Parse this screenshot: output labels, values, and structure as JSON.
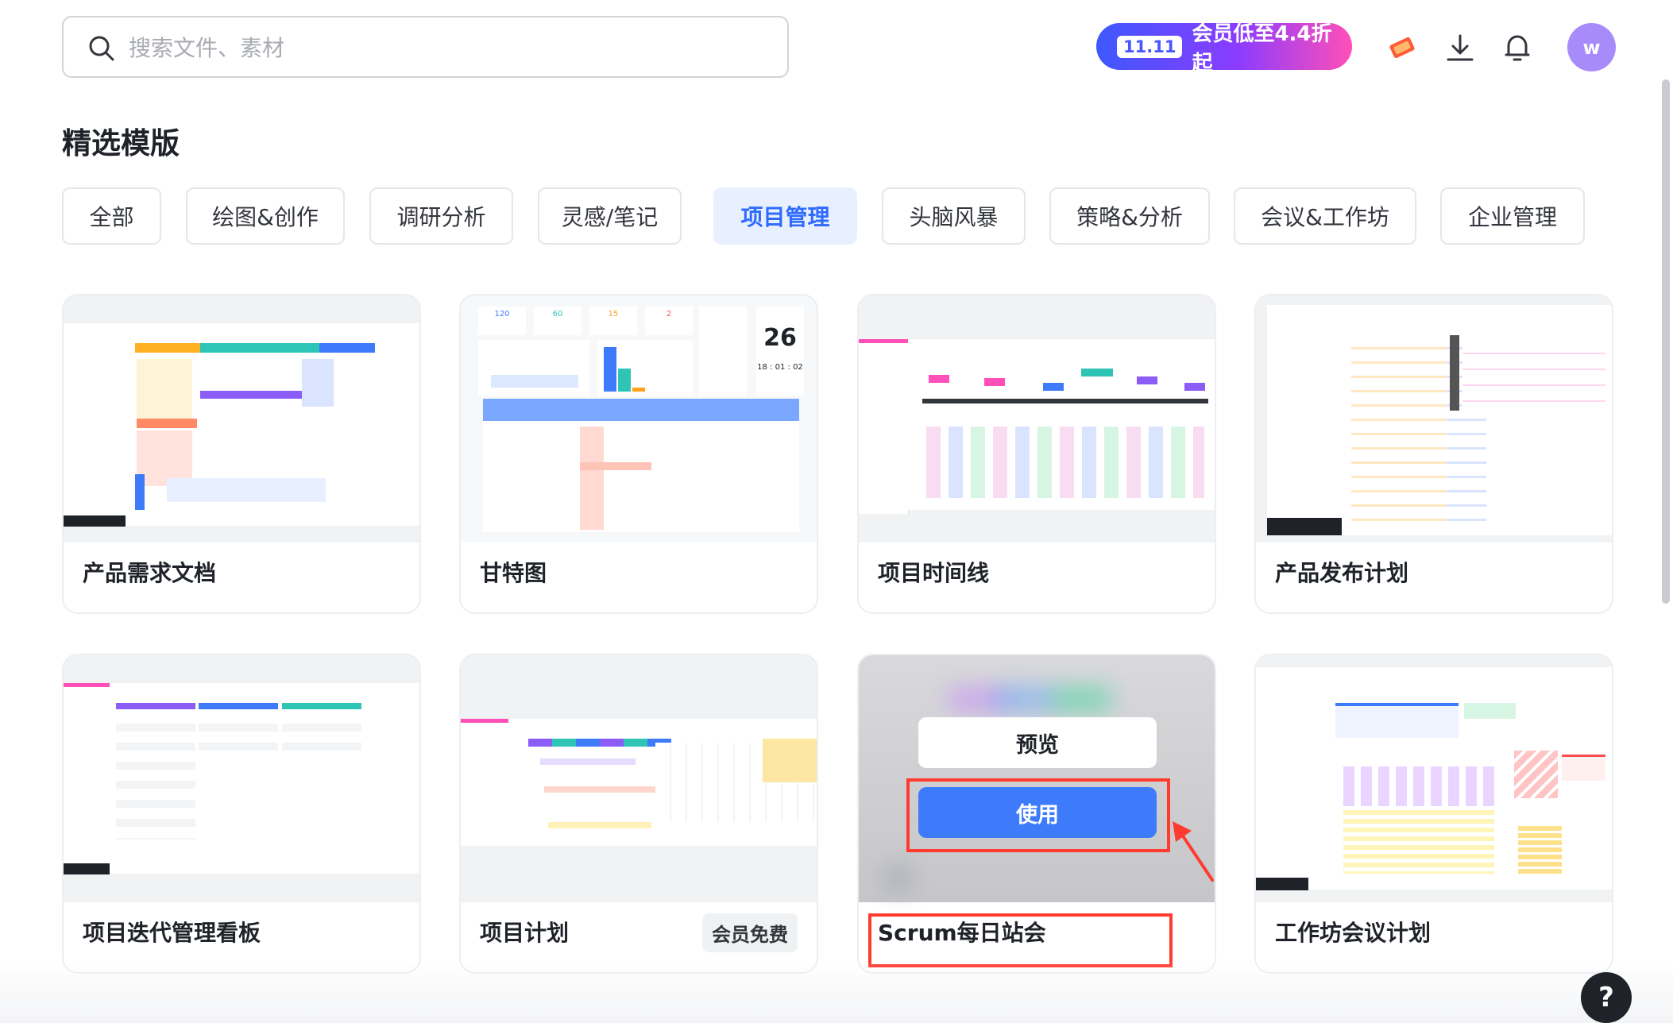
{
  "search": {
    "placeholder": "搜索文件、素材"
  },
  "promo": {
    "tag": "11.11",
    "text": "会员低至4.4折起"
  },
  "header_icons": [
    "ticket-icon",
    "download-icon",
    "bell-icon"
  ],
  "avatar": {
    "initial": "w",
    "color": "#a78bfa"
  },
  "section_title": "精选模版",
  "tabs": [
    "全部",
    "绘图&创作",
    "调研分析",
    "灵感/笔记",
    "项目管理",
    "头脑风暴",
    "策略&分析",
    "会议&工作坊",
    "企业管理"
  ],
  "active_tab": "项目管理",
  "cards": [
    {
      "title": "产品需求文档"
    },
    {
      "title": "甘特图"
    },
    {
      "title": "项目时间线"
    },
    {
      "title": "产品发布计划"
    },
    {
      "title": "项目迭代管理看板"
    },
    {
      "title": "项目计划",
      "badge": "会员免费"
    },
    {
      "title": "Scrum每日站会",
      "hover": {
        "preview": "预览",
        "use": "使用"
      }
    },
    {
      "title": "工作坊会议计划"
    }
  ],
  "gantt_thumb": {
    "stats": [
      "120",
      "60",
      "15",
      "2"
    ],
    "day": "26",
    "clock": "18 : 01 : 02"
  },
  "help": "?",
  "colors": {
    "accent": "#3e7bfa",
    "tab_active_bg": "#e8f0ff",
    "annotation": "#ff3b30"
  }
}
